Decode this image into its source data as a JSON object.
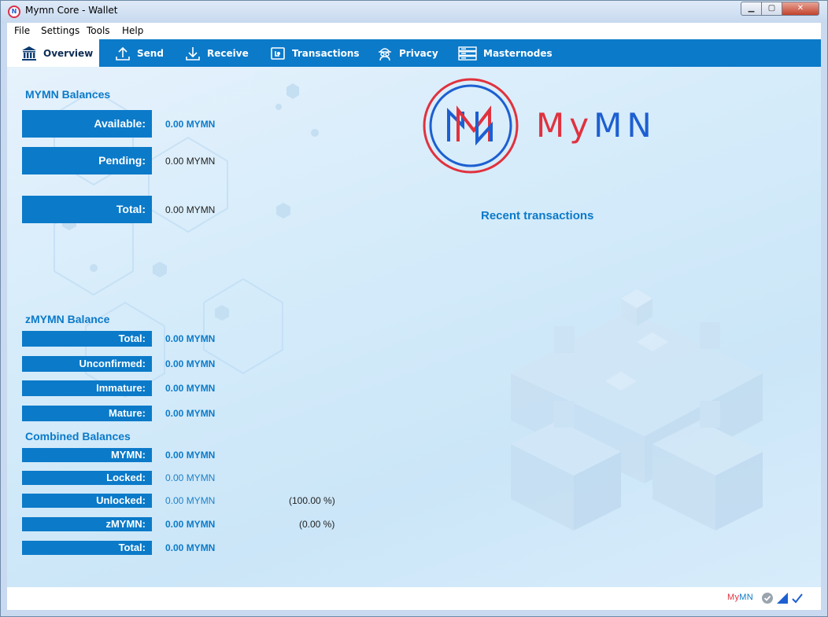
{
  "window": {
    "title": "Mymn Core - Wallet",
    "icon": "mymn-app-icon",
    "controls": {
      "minimize": "▁",
      "maximize": "▢",
      "close": "✕"
    }
  },
  "menu": {
    "items": [
      "File",
      "Settings",
      "Tools",
      "Help"
    ]
  },
  "tabs": [
    {
      "label": "Overview",
      "icon": "bank-icon",
      "active": true
    },
    {
      "label": "Send",
      "icon": "upload-icon",
      "active": false
    },
    {
      "label": "Receive",
      "icon": "download-icon",
      "active": false
    },
    {
      "label": "Transactions",
      "icon": "wallet-icon",
      "active": false
    },
    {
      "label": "Privacy",
      "icon": "spy-icon",
      "active": false
    },
    {
      "label": "Masternodes",
      "icon": "server-icon",
      "active": false
    }
  ],
  "mymn_balances": {
    "title": "MYMN Balances",
    "available_label": "Available:",
    "available_value": "0.00 MYMN",
    "pending_label": "Pending:",
    "pending_value": "0.00 MYMN",
    "total_label": "Total:",
    "total_value": "0.00 MYMN"
  },
  "zmymn_balance": {
    "title": "zMYMN Balance",
    "total_label": "Total:",
    "total_value": "0.00 MYMN",
    "unconfirmed_label": "Unconfirmed:",
    "unconfirmed_value": "0.00 MYMN",
    "immature_label": "Immature:",
    "immature_value": "0.00 MYMN",
    "mature_label": "Mature:",
    "mature_value": "0.00 MYMN"
  },
  "combined_balances": {
    "title": "Combined Balances",
    "mymn_label": "MYMN:",
    "mymn_value": "0.00 MYMN",
    "locked_label": "Locked:",
    "locked_value": "0.00 MYMN",
    "unlocked_label": "Unlocked:",
    "unlocked_value": "0.00 MYMN",
    "unlocked_pct": "(100.00 %)",
    "zmymn_label": "zMYMN:",
    "zmymn_value": "0.00 MYMN",
    "zmymn_pct": "(0.00 %)",
    "total_label": "Total:",
    "total_value": "0.00 MYMN"
  },
  "logo": {
    "wordmark_red": "My",
    "wordmark_blue": "MN"
  },
  "recent": {
    "title": "Recent transactions"
  },
  "status": {
    "brand_red": "My",
    "brand_blue": "MN",
    "icons": [
      "verified-check-icon",
      "signal-icon",
      "sync-check-icon"
    ]
  },
  "colors": {
    "accent": "#0b7ac9",
    "brand_red": "#e0323e",
    "brand_blue": "#1d5fd1"
  }
}
